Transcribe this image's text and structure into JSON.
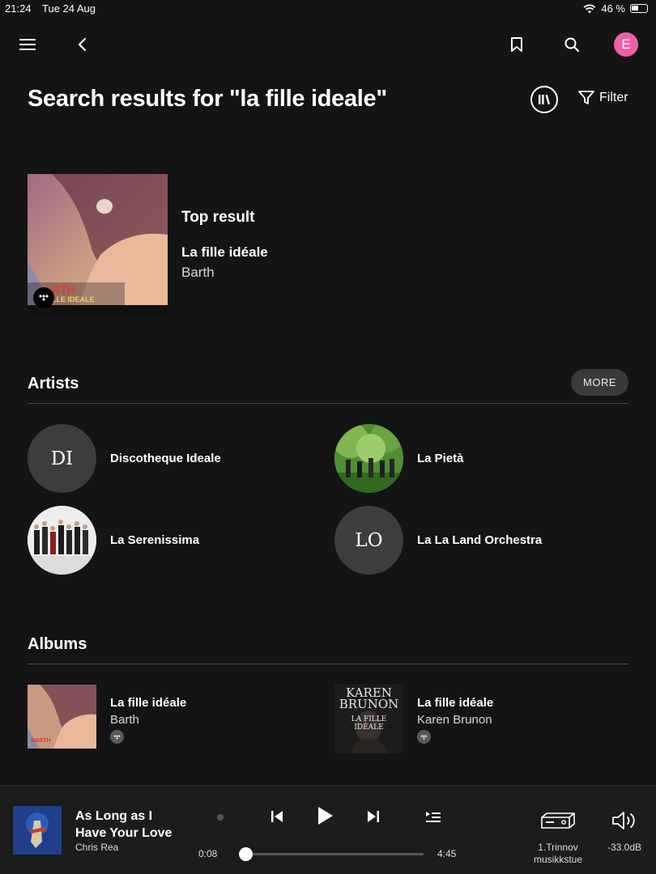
{
  "status_bar": {
    "time": "21:24",
    "date": "Tue 24 Aug",
    "battery": "46 %"
  },
  "nav": {
    "avatar_letter": "E"
  },
  "page": {
    "title": "Search results for \"la fille ideale\"",
    "filter_label": "Filter"
  },
  "top_result": {
    "label": "Top result",
    "title": "La fille idéale",
    "artist": "Barth",
    "art_text_1": "RTH",
    "art_text_2": "LLE IDEALE"
  },
  "artists": {
    "heading": "Artists",
    "more_label": "MORE",
    "items": [
      {
        "initials": "DI",
        "name": "Discotheque Ideale"
      },
      {
        "initials": "",
        "name": "La Pietà"
      },
      {
        "initials": "",
        "name": "La Serenissima"
      },
      {
        "initials": "LO",
        "name": "La La Land Orchestra"
      }
    ]
  },
  "albums": {
    "heading": "Albums",
    "items": [
      {
        "title": "La fille idéale",
        "artist": "Barth",
        "art_text": "BARTH"
      },
      {
        "title": "La fille idéale",
        "artist": "Karen Brunon",
        "art_text_1": "KAREN",
        "art_text_2": "BRUNON",
        "art_text_3": "LA FILLE",
        "art_text_4": "IDÉALE"
      }
    ]
  },
  "now_playing": {
    "song": "As Long as I Have Your Love",
    "artist": "Chris Rea",
    "elapsed": "0:08",
    "duration": "4:45",
    "progress_fraction": 0.028,
    "zone": "1.Trinnov musikkstue",
    "volume": "-33.0dB"
  },
  "colors": {
    "background": "#141414",
    "player_bg": "#1c1c1c",
    "avatar": "#ef5fa7",
    "pill": "#3a3a3a"
  }
}
